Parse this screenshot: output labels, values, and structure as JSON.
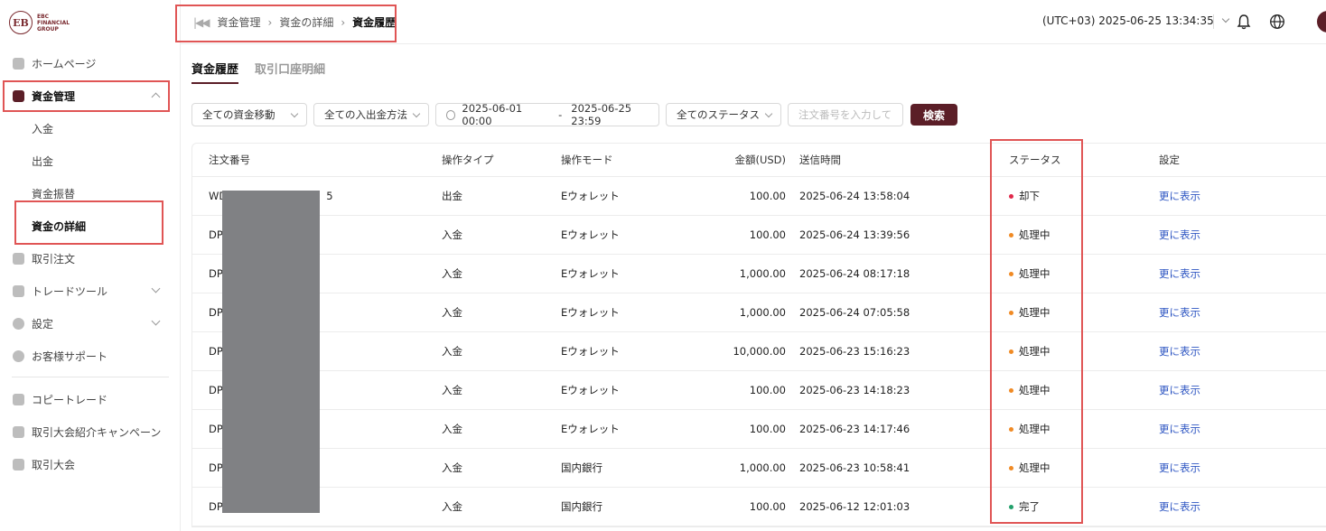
{
  "logo": {
    "mark": "EB",
    "line1": "EBC",
    "line2": "FINANCIAL",
    "line3": "GROUP"
  },
  "sidebar": {
    "items": [
      {
        "label": "ホームページ"
      },
      {
        "label": "資金管理"
      },
      {
        "label": "入金"
      },
      {
        "label": "出金"
      },
      {
        "label": "資金振替"
      },
      {
        "label": "資金の詳細"
      },
      {
        "label": "取引注文"
      },
      {
        "label": "トレードツール"
      },
      {
        "label": "設定"
      },
      {
        "label": "お客様サポート"
      },
      {
        "label": "コピートレード"
      },
      {
        "label": "取引大会紹介キャンペーン"
      },
      {
        "label": "取引大会"
      }
    ]
  },
  "header": {
    "breadcrumb": [
      "資金管理",
      "資金の詳細",
      "資金履歴"
    ],
    "timezone": "(UTC+03)  2025-06-25 13:34:35"
  },
  "tabs": [
    "資金履歴",
    "取引口座明細"
  ],
  "filters": {
    "movement": "全ての資金移動",
    "method": "全ての入出金方法",
    "date_start": "2025-06-01 00:00",
    "date_sep": "-",
    "date_end": "2025-06-25 23:59",
    "status": "全てのステータス",
    "order_placeholder": "注文番号を入力して",
    "search_label": "検索"
  },
  "table": {
    "headers": [
      "注文番号",
      "操作タイプ",
      "操作モード",
      "金額(USD)",
      "送信時間",
      "ステータス",
      "設定"
    ],
    "rows": [
      {
        "order": "WD",
        "order_tail": "5",
        "type": "出金",
        "mode": "Eウォレット",
        "amount": "100.00",
        "time": "2025-06-24 13:58:04",
        "status": "却下",
        "status_color": "#e0284a",
        "action": "更に表示"
      },
      {
        "order": "DP",
        "order_tail": "",
        "type": "入金",
        "mode": "Eウォレット",
        "amount": "100.00",
        "time": "2025-06-24 13:39:56",
        "status": "処理中",
        "status_color": "#f08a24",
        "action": "更に表示"
      },
      {
        "order": "DP",
        "order_tail": "",
        "type": "入金",
        "mode": "Eウォレット",
        "amount": "1,000.00",
        "time": "2025-06-24 08:17:18",
        "status": "処理中",
        "status_color": "#f08a24",
        "action": "更に表示"
      },
      {
        "order": "DP",
        "order_tail": "",
        "type": "入金",
        "mode": "Eウォレット",
        "amount": "1,000.00",
        "time": "2025-06-24 07:05:58",
        "status": "処理中",
        "status_color": "#f08a24",
        "action": "更に表示"
      },
      {
        "order": "DP",
        "order_tail": "",
        "type": "入金",
        "mode": "Eウォレット",
        "amount": "10,000.00",
        "time": "2025-06-23 15:16:23",
        "status": "処理中",
        "status_color": "#f08a24",
        "action": "更に表示"
      },
      {
        "order": "DP",
        "order_tail": "",
        "type": "入金",
        "mode": "Eウォレット",
        "amount": "100.00",
        "time": "2025-06-23 14:18:23",
        "status": "処理中",
        "status_color": "#f08a24",
        "action": "更に表示"
      },
      {
        "order": "DP",
        "order_tail": "",
        "type": "入金",
        "mode": "Eウォレット",
        "amount": "100.00",
        "time": "2025-06-23 14:17:46",
        "status": "処理中",
        "status_color": "#f08a24",
        "action": "更に表示"
      },
      {
        "order": "DP",
        "order_tail": "",
        "type": "入金",
        "mode": "国内銀行",
        "amount": "1,000.00",
        "time": "2025-06-23 10:58:41",
        "status": "処理中",
        "status_color": "#f08a24",
        "action": "更に表示"
      },
      {
        "order": "DP",
        "order_tail": "",
        "type": "入金",
        "mode": "国内銀行",
        "amount": "100.00",
        "time": "2025-06-12 12:01:03",
        "status": "完了",
        "status_color": "#22a06b",
        "action": "更に表示"
      }
    ]
  },
  "colors": {
    "brand": "#5b1e27",
    "link": "#2d55c2",
    "highlight": "#e05555"
  }
}
